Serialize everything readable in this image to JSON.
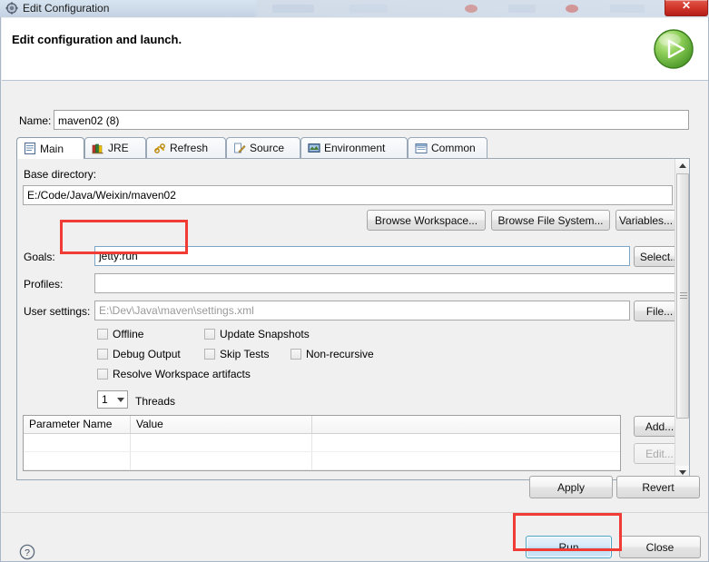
{
  "window": {
    "title": "Edit Configuration",
    "title_icon": "eclipse-config-icon",
    "close_label": "✕"
  },
  "banner": {
    "heading": "Edit configuration and launch.",
    "icon": "green-run-play-icon"
  },
  "name_row": {
    "label": "Name:",
    "value": "maven02 (8)"
  },
  "tabs": [
    {
      "label": "Main",
      "icon": "main-document-icon",
      "selected": true
    },
    {
      "label": "JRE",
      "icon": "jre-library-icon",
      "selected": false
    },
    {
      "label": "Refresh",
      "icon": "refresh-link-icon",
      "selected": false
    },
    {
      "label": "Source",
      "icon": "source-pencil-icon",
      "selected": false
    },
    {
      "label": "Environment",
      "icon": "environment-screen-icon",
      "selected": false
    },
    {
      "label": "Common",
      "icon": "common-window-icon",
      "selected": false
    }
  ],
  "main_tab": {
    "base_directory": {
      "label": "Base directory:",
      "value": "E:/Code/Java/Weixin/maven02"
    },
    "dir_buttons": [
      {
        "label": "Browse Workspace..."
      },
      {
        "label": "Browse File System..."
      },
      {
        "label": "Variables..."
      }
    ],
    "goals": {
      "label": "Goals:",
      "value": "jetty:run",
      "button": "Select...",
      "highlighted": true
    },
    "profiles": {
      "label": "Profiles:",
      "value": ""
    },
    "user_settings": {
      "label": "User settings:",
      "value": "E:\\Dev\\Java\\maven\\settings.xml",
      "button": "File..."
    },
    "checkboxes": [
      {
        "label": "Offline",
        "checked": false
      },
      {
        "label": "Update Snapshots",
        "checked": false
      },
      {
        "label": "Debug Output",
        "checked": false
      },
      {
        "label": "Skip Tests",
        "checked": false
      },
      {
        "label": "Non-recursive",
        "checked": false
      },
      {
        "label": "Resolve Workspace artifacts",
        "checked": false
      }
    ],
    "threads": {
      "value": "1",
      "label": "Threads"
    },
    "parameter_table": {
      "columns": [
        "Parameter Name",
        "Value"
      ],
      "rows": [],
      "buttons": [
        {
          "label": "Add...",
          "enabled": true
        },
        {
          "label": "Edit...",
          "enabled": false
        }
      ]
    }
  },
  "footer": {
    "apply_label": "Apply",
    "revert_label": "Revert",
    "run_label": "Run",
    "close_label": "Close",
    "help_icon": "help-question-icon",
    "run_highlighted": true
  },
  "colors": {
    "annotation": "#f03c34",
    "default_button_border": "#4aa5c4",
    "title_gradient_start": "#d6e3f0",
    "close_button": "#d2362a"
  }
}
